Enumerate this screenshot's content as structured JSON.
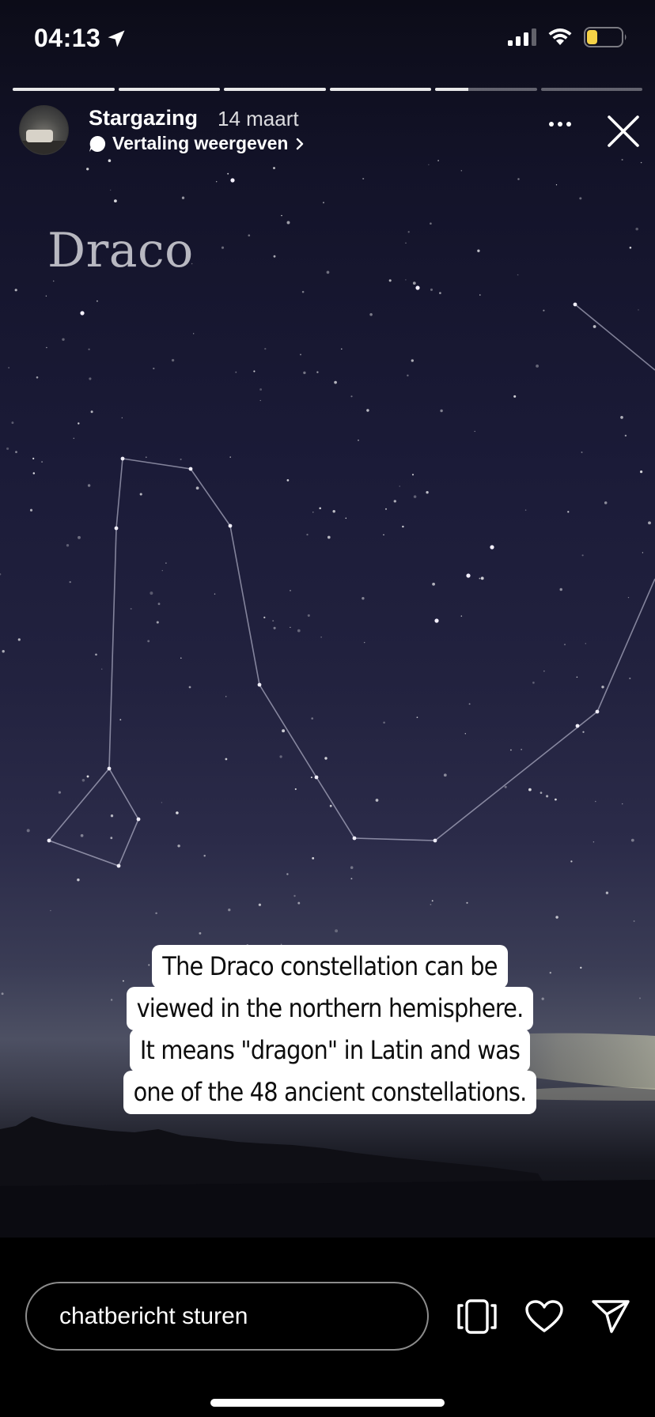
{
  "status_bar": {
    "time": "04:13",
    "icons": [
      "location-arrow-icon",
      "signal-icon",
      "wifi-icon",
      "battery-icon"
    ],
    "battery_color": "#f5d247"
  },
  "story": {
    "segments_total": 6,
    "progress": [
      1,
      1,
      1,
      1,
      0.33,
      0
    ],
    "author": "Stargazing",
    "date": "14 maart",
    "translate_label": "Vertaling weergeven",
    "title_overlay": "Draco",
    "caption_lines": [
      "The Draco constellation can be",
      "viewed in the northern hemisphere.",
      "It means \"dragon\" in Latin and was",
      "one of the 48 ancient constellations."
    ]
  },
  "bottom_bar": {
    "input_placeholder": "chatbericht sturen",
    "actions": [
      "share-screen-icon",
      "heart-icon",
      "send-icon"
    ]
  },
  "colors": {
    "sky_top": "#0c0c18",
    "sky_mid": "#22223f",
    "horizon": "#4d5063",
    "caption_bg": "#ffffff",
    "caption_text": "#0d0d0d"
  }
}
